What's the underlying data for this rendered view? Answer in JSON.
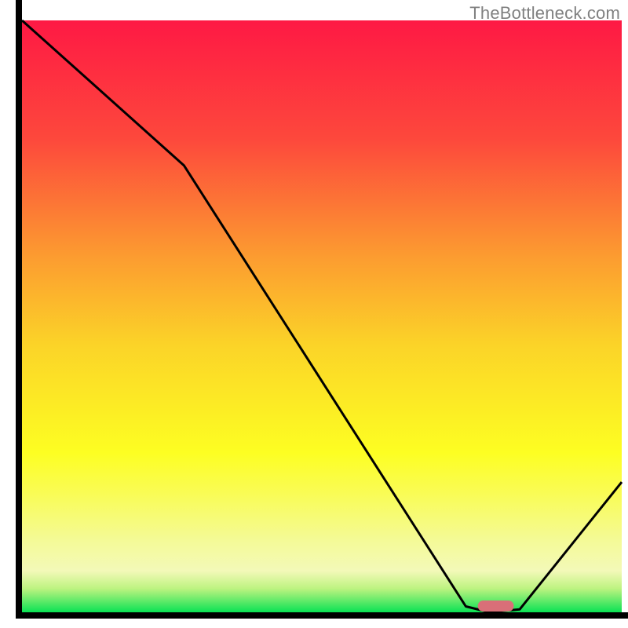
{
  "watermark": "TheBottleneck.com",
  "chart_data": {
    "type": "line",
    "title": "",
    "xlabel": "",
    "ylabel": "",
    "xlim": [
      0,
      100
    ],
    "ylim": [
      0,
      100
    ],
    "x": [
      0,
      27,
      74,
      78,
      83,
      100
    ],
    "values": [
      100,
      75.5,
      1,
      0,
      0.5,
      22
    ],
    "marker": {
      "x_start": 76,
      "x_end": 82,
      "color": "#d96f78"
    },
    "gradient_stops": [
      {
        "offset": 0.0,
        "color": "#fe1944"
      },
      {
        "offset": 0.2,
        "color": "#fd483c"
      },
      {
        "offset": 0.4,
        "color": "#fc9c30"
      },
      {
        "offset": 0.55,
        "color": "#fbd428"
      },
      {
        "offset": 0.73,
        "color": "#fdfe22"
      },
      {
        "offset": 0.8,
        "color": "#f9fc56"
      },
      {
        "offset": 0.88,
        "color": "#f4fa98"
      },
      {
        "offset": 0.93,
        "color": "#f3f9b8"
      },
      {
        "offset": 0.96,
        "color": "#bdf380"
      },
      {
        "offset": 1.0,
        "color": "#0ae254"
      }
    ],
    "axes": {
      "color": "#000000",
      "width": 8
    }
  }
}
